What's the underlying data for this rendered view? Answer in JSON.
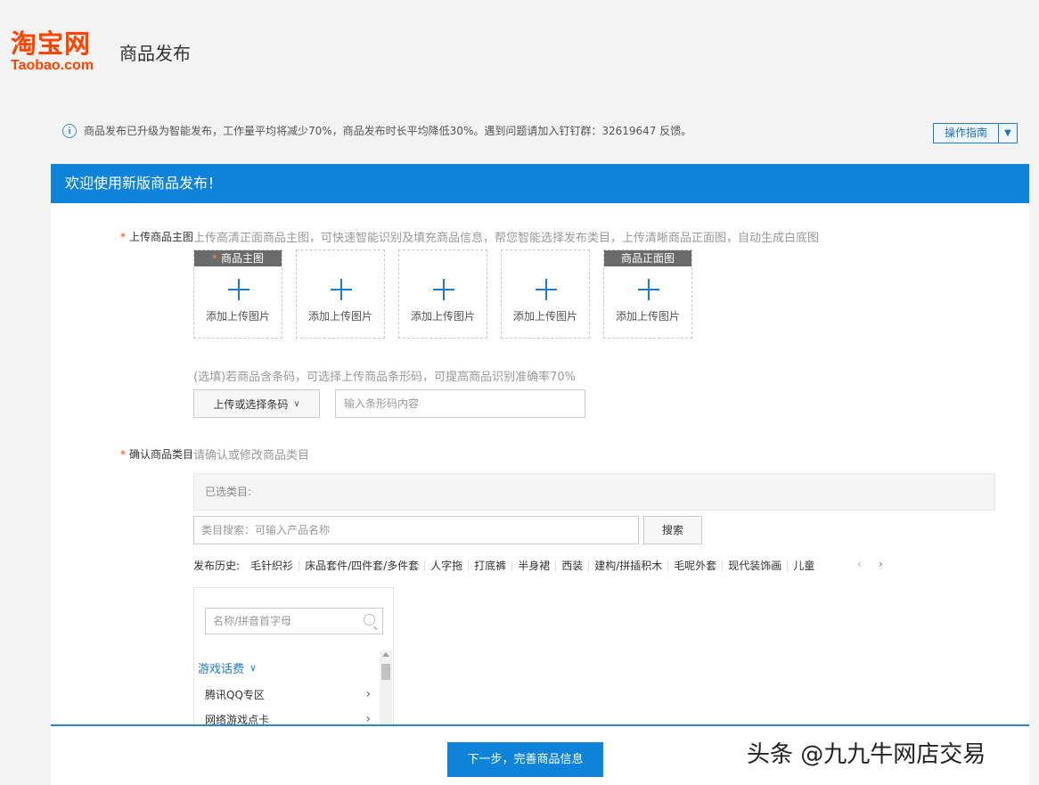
{
  "header": {
    "logo_cn": "淘宝网",
    "logo_en": "Taobao.com",
    "page_title": "商品发布"
  },
  "notice": {
    "text": "商品发布已升级为智能发布，工作量平均将减少70%，商品发布时长平均降低30%。遇到问题请加入钉钉群：32619647 反馈。",
    "guide_label": "操作指南"
  },
  "banner": {
    "title": "欢迎使用新版商品发布！"
  },
  "main_image": {
    "label": "上传商品主图",
    "hint": "上传高清正面商品主图，可快速智能识别及填充商品信息，帮您智能选择发布类目，上传清晰商品正面图，自动生成白底图",
    "slots": [
      {
        "tag": "商品主图",
        "required": true,
        "text": "添加上传图片"
      },
      {
        "tag": "",
        "required": false,
        "text": "添加上传图片"
      },
      {
        "tag": "",
        "required": false,
        "text": "添加上传图片"
      },
      {
        "tag": "",
        "required": false,
        "text": "添加上传图片"
      },
      {
        "tag": "商品正面图",
        "required": false,
        "text": "添加上传图片"
      }
    ]
  },
  "barcode": {
    "hint": "(选填)若商品含条码，可选择上传商品条形码，可提高商品识别准确率70%",
    "button_label": "上传或选择条码",
    "input_placeholder": "输入条形码内容"
  },
  "category": {
    "label": "确认商品类目",
    "hint": "请确认或修改商品类目",
    "selected_label": "已选类目:",
    "search_placeholder": "类目搜索：可输入产品名称",
    "search_button": "搜索",
    "history_label": "发布历史:",
    "history": [
      "毛针织衫",
      "床品套件/四件套/多件套",
      "人字拖",
      "打底裤",
      "半身裙",
      "西装",
      "建构/拼插积木",
      "毛呢外套",
      "现代装饰画",
      "儿童"
    ],
    "tree": {
      "search_placeholder": "名称/拼音首字母",
      "group": "游戏话费",
      "items": [
        "腾讯QQ专区",
        "网络游戏点卡"
      ]
    }
  },
  "footer": {
    "next_button": "下一步，完善商品信息"
  },
  "watermark": "头条 @九九牛网店交易",
  "colors": {
    "brand": "#ff4400",
    "primary": "#0e83d9",
    "link": "#1f7acb"
  }
}
